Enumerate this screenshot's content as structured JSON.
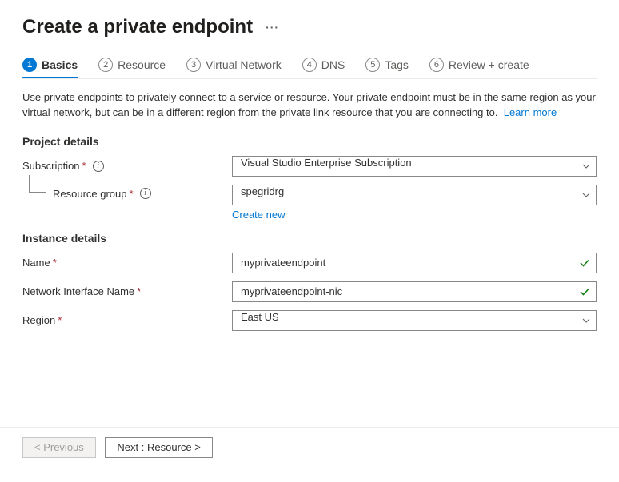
{
  "title": "Create a private endpoint",
  "more_icon": "···",
  "tabs": [
    {
      "num": "1",
      "label": "Basics",
      "active": true
    },
    {
      "num": "2",
      "label": "Resource",
      "active": false
    },
    {
      "num": "3",
      "label": "Virtual Network",
      "active": false
    },
    {
      "num": "4",
      "label": "DNS",
      "active": false
    },
    {
      "num": "5",
      "label": "Tags",
      "active": false
    },
    {
      "num": "6",
      "label": "Review + create",
      "active": false
    }
  ],
  "description": "Use private endpoints to privately connect to a service or resource. Your private endpoint must be in the same region as your virtual network, but can be in a different region from the private link resource that you are connecting to.",
  "learn_more": "Learn more",
  "sections": {
    "project": {
      "heading": "Project details",
      "subscription": {
        "label": "Subscription",
        "value": "Visual Studio Enterprise Subscription"
      },
      "resource_group": {
        "label": "Resource group",
        "value": "spegridrg",
        "create_new": "Create new"
      }
    },
    "instance": {
      "heading": "Instance details",
      "name": {
        "label": "Name",
        "value": "myprivateendpoint"
      },
      "nic": {
        "label": "Network Interface Name",
        "value": "myprivateendpoint-nic"
      },
      "region": {
        "label": "Region",
        "value": "East US"
      }
    }
  },
  "footer": {
    "prev": "< Previous",
    "next": "Next : Resource >"
  }
}
